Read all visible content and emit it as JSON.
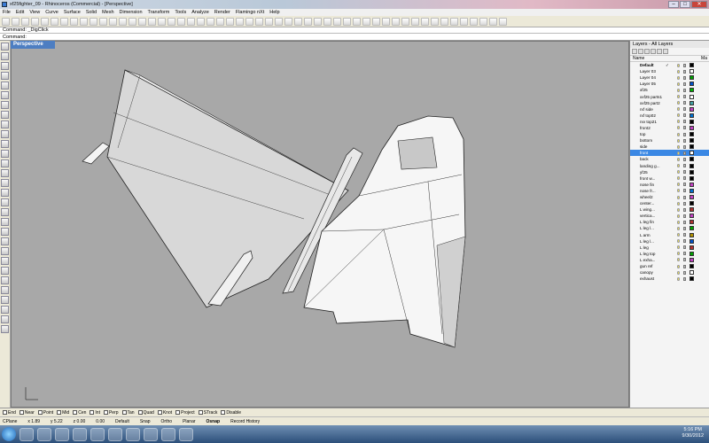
{
  "window": {
    "title": "xf25fighter_09 - Rhinoceros (Commercial) - [Perspective]"
  },
  "menu": [
    "File",
    "Edit",
    "View",
    "Curve",
    "Surface",
    "Solid",
    "Mesh",
    "Dimension",
    "Transform",
    "Tools",
    "Analyze",
    "Render",
    "Flamingo nXt",
    "Help"
  ],
  "command": {
    "history": "Command: _DigClick",
    "prompt": "Command:"
  },
  "viewport": {
    "label": "Perspective"
  },
  "layers": {
    "panel_title": "Layers - All Layers",
    "column_name": "Name",
    "column_material": "Ma",
    "rows": [
      {
        "name": "Default",
        "check": "✓",
        "color": "#000000",
        "bold": true
      },
      {
        "name": "Layer 03",
        "color": "#ffffff"
      },
      {
        "name": "Layer 04",
        "color": "#00a000"
      },
      {
        "name": "Layer 05",
        "color": "#0050c8"
      },
      {
        "name": "xf25",
        "color": "#00b000"
      },
      {
        "name": "xxf25 parts1",
        "color": "#ffffff"
      },
      {
        "name": "xxf25 part2",
        "color": "#40a0a0"
      },
      {
        "name": "rxf side",
        "color": "#c040c0"
      },
      {
        "name": "rxf top02",
        "color": "#0070d0"
      },
      {
        "name": "rxv top21",
        "color": "#000000"
      },
      {
        "name": "front2",
        "color": "#c040c0"
      },
      {
        "name": "top",
        "color": "#000000"
      },
      {
        "name": "bottom",
        "color": "#000000"
      },
      {
        "name": "side",
        "color": "#000000"
      },
      {
        "name": "front",
        "color": "#ffffff",
        "selected": true
      },
      {
        "name": "back",
        "color": "#000000"
      },
      {
        "name": "landing g...",
        "color": "#000000"
      },
      {
        "name": "yf25",
        "color": "#000000"
      },
      {
        "name": "front w...",
        "color": "#000000"
      },
      {
        "name": "nose fin",
        "color": "#c040c0"
      },
      {
        "name": "nose fr...",
        "color": "#0070d0"
      },
      {
        "name": "wheel2",
        "color": "#c040c0"
      },
      {
        "name": "center...",
        "color": "#000000"
      },
      {
        "name": "L wing...",
        "color": "#b03030"
      },
      {
        "name": "vertica...",
        "color": "#c040c0"
      },
      {
        "name": "L leg fin",
        "color": "#b03030"
      },
      {
        "name": "L leg l...",
        "color": "#00a000"
      },
      {
        "name": "L arm",
        "color": "#b09000"
      },
      {
        "name": "L leg l...",
        "color": "#0050c8"
      },
      {
        "name": "L leg",
        "color": "#b03030"
      },
      {
        "name": "L leg top",
        "color": "#00a000"
      },
      {
        "name": "L exha...",
        "color": "#c040c0"
      },
      {
        "name": "gun ref",
        "color": "#000000"
      },
      {
        "name": "canopy",
        "color": "#ffffff"
      },
      {
        "name": "exhaust",
        "color": "#000000"
      }
    ]
  },
  "snaps": [
    "End",
    "Near",
    "Point",
    "Mid",
    "Cen",
    "Int",
    "Perp",
    "Tan",
    "Quad",
    "Knot",
    "Project",
    "STrack",
    "Disable"
  ],
  "status": {
    "cplane": "CPlane",
    "x": "x 1.89",
    "y": "y 5.22",
    "z": "z 0.00",
    "v": "0.00",
    "layer": "Default",
    "snap": "Snap",
    "ortho": "Ortho",
    "planar": "Planar",
    "osnap": "Osnap",
    "record": "Record History"
  },
  "clock": {
    "time": "5:16 PM",
    "date": "9/30/2012"
  },
  "colors": {
    "viewport": "#a8a8a8",
    "tab": "#4d7ec2",
    "selection": "#3b88e4"
  }
}
